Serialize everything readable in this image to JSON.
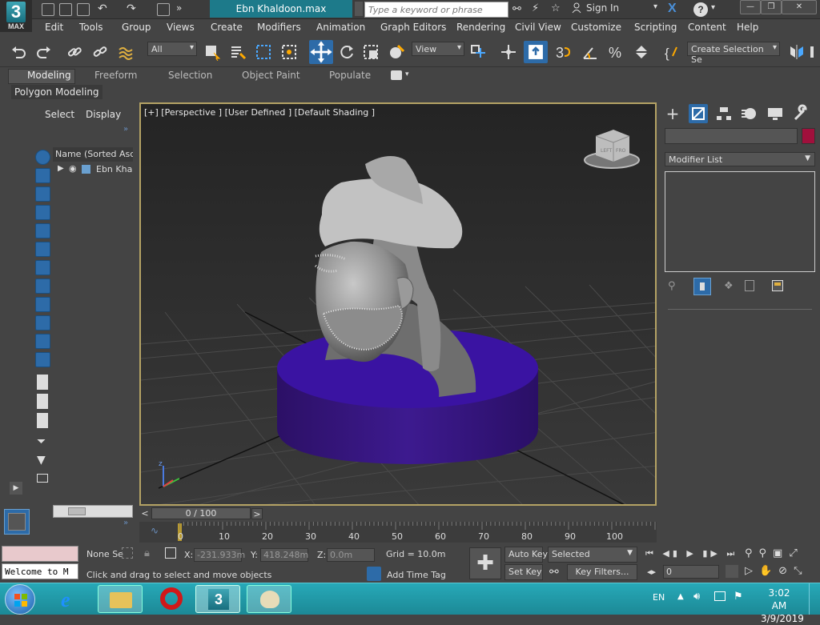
{
  "app": {
    "logo_digit": "3",
    "logo_text": "MAX",
    "doc_title": "Ebn Khaldoon.max"
  },
  "search": {
    "placeholder": "Type a keyword or phrase"
  },
  "account": {
    "signin": "Sign In"
  },
  "menu": [
    "Edit",
    "Tools",
    "Group",
    "Views",
    "Create",
    "Modifiers",
    "Animation",
    "Graph Editors",
    "Rendering",
    "Civil View",
    "Customize",
    "Scripting",
    "Content",
    "Help"
  ],
  "toolbar": {
    "filter": "All",
    "refcoord": "View",
    "selection_set": "Create Selection Se"
  },
  "ribbon": {
    "tabs": [
      "Modeling",
      "Freeform",
      "Selection",
      "Object Paint",
      "Populate"
    ],
    "panel": "Polygon Modeling"
  },
  "explorer": {
    "tabs": [
      "Select",
      "Display"
    ],
    "column": "Name (Sorted Ascen",
    "item": "Ebn Khaldoon"
  },
  "viewport": {
    "label": "[+] [Perspective ] [User Defined ] [Default Shading ]"
  },
  "command_panel": {
    "modifier_list": "Modifier List",
    "object_color": "#a0103c"
  },
  "time": {
    "slider": "0 / 100",
    "ticks": [
      "0",
      "10",
      "20",
      "30",
      "40",
      "50",
      "60",
      "70",
      "80",
      "90",
      "100"
    ]
  },
  "status": {
    "maxscript": "Welcome to M",
    "selection": "None Se",
    "x_label": "X:",
    "x_value": "-231.933m",
    "y_label": "Y:",
    "y_value": "418.248m",
    "z_label": "Z:",
    "z_value": "0.0m",
    "grid": "Grid = 10.0m",
    "prompt": "Click and drag to select and move objects",
    "add_time_tag": "Add Time Tag",
    "auto_key": "Auto Key",
    "set_key": "Set Key",
    "key_mode": "Selected",
    "key_filters": "Key Filters...",
    "frame": "0"
  },
  "taskbar": {
    "lang": "EN",
    "time": "3:02 AM",
    "date": "3/9/2019"
  },
  "colors": {
    "base": "#3d1a8f",
    "taskbar": "#1c8996",
    "viewport_border": "#b4a264"
  }
}
